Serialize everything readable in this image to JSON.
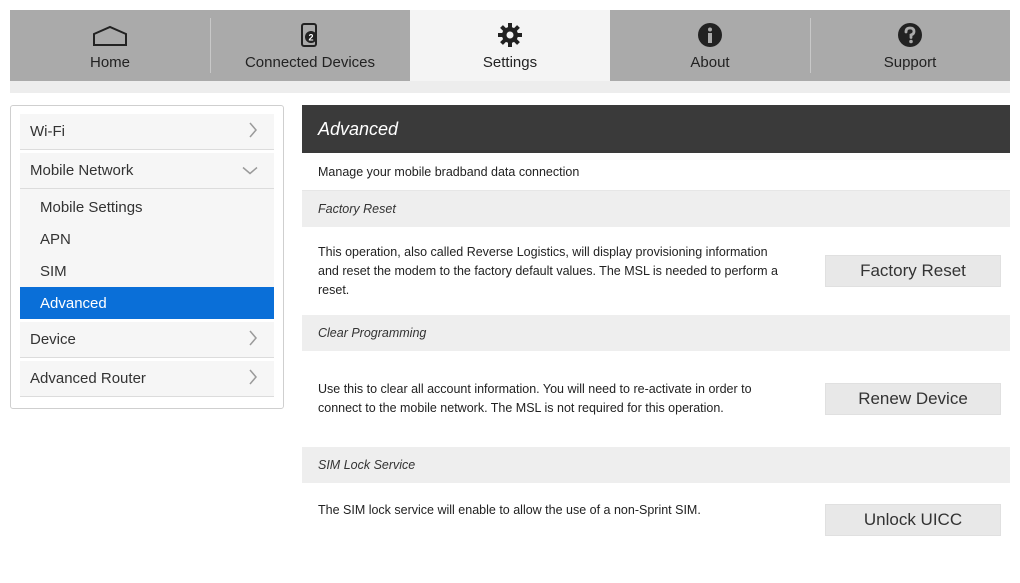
{
  "nav": {
    "tabs": [
      {
        "label": "Home",
        "icon": "home-icon"
      },
      {
        "label": "Connected Devices",
        "icon": "connected-devices-icon",
        "badge": "2"
      },
      {
        "label": "Settings",
        "icon": "gear-icon",
        "active": true
      },
      {
        "label": "About",
        "icon": "info-icon"
      },
      {
        "label": "Support",
        "icon": "help-icon"
      }
    ]
  },
  "sidebar": {
    "items": [
      {
        "label": "Wi-Fi",
        "icon": "chevron-right-icon"
      },
      {
        "label": "Mobile Network",
        "icon": "chevron-down-icon",
        "expanded": true,
        "children": [
          "Mobile Settings",
          "APN",
          "SIM",
          "Advanced"
        ],
        "selected": "Advanced"
      },
      {
        "label": "Device",
        "icon": "chevron-right-icon"
      },
      {
        "label": "Advanced Router",
        "icon": "chevron-right-icon"
      }
    ]
  },
  "main": {
    "title": "Advanced",
    "description": "Manage your mobile bradband data connection",
    "sections": [
      {
        "heading": "Factory Reset",
        "text": "This operation, also called Reverse Logistics, will display provisioning information and reset the modem to the factory default values. The MSL is needed to perform a reset.",
        "button": "Factory Reset"
      },
      {
        "heading": "Clear Programming",
        "text": "Use this to clear all account information. You will need to re-activate in order to connect to the mobile network. The MSL is not required for this operation.",
        "button": "Renew Device"
      },
      {
        "heading": "SIM Lock Service",
        "text": "The SIM lock service will enable to allow the use of a non-Sprint SIM.",
        "button": "Unlock UICC"
      }
    ]
  },
  "colors": {
    "selected": "#0a6fd8",
    "title_bar": "#3a3a3a",
    "nav_bg": "#aaaaaa"
  }
}
